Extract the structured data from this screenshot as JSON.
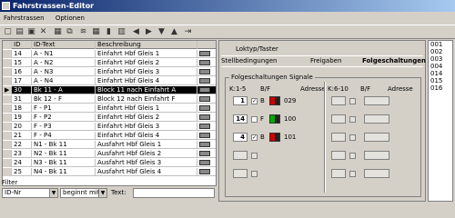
{
  "window": {
    "title": "Fahrstrassen-Editor"
  },
  "menu": {
    "items": [
      "Fahrstrassen",
      "Optionen"
    ]
  },
  "grid": {
    "headers": [
      "",
      "ID",
      "ID-Text",
      "Beschreibung",
      ""
    ],
    "rows": [
      {
        "marker": "",
        "id": "14",
        "text": "A - N1",
        "desc": "Einfahrt Hbf Gleis 1"
      },
      {
        "marker": "",
        "id": "15",
        "text": "A - N2",
        "desc": "Einfahrt Hbf Gleis 2"
      },
      {
        "marker": "",
        "id": "16",
        "text": "A - N3",
        "desc": "Einfahrt Hbf Gleis 3"
      },
      {
        "marker": "",
        "id": "17",
        "text": "A - N4",
        "desc": "Einfahrt Hbf Gleis 4"
      },
      {
        "marker": "▶",
        "id": "30",
        "text": "Bk 11 - A",
        "desc": "Block 11 nach Einfahrt A"
      },
      {
        "marker": "",
        "id": "31",
        "text": "Bk 12 - F",
        "desc": "Block 12 nach Einfahrt F"
      },
      {
        "marker": "",
        "id": "18",
        "text": "F - P1",
        "desc": "Einfahrt Hbf Gleis 1"
      },
      {
        "marker": "",
        "id": "19",
        "text": "F - P2",
        "desc": "Einfahrt Hbf Gleis 2"
      },
      {
        "marker": "",
        "id": "20",
        "text": "F - P3",
        "desc": "Einfahrt Hbf Gleis 3"
      },
      {
        "marker": "",
        "id": "21",
        "text": "F - P4",
        "desc": "Einfahrt Hbf Gleis 4"
      },
      {
        "marker": "",
        "id": "22",
        "text": "N1 - Bk 11",
        "desc": "Ausfahrt Hbf Gleis 1"
      },
      {
        "marker": "",
        "id": "23",
        "text": "N2 - Bk 11",
        "desc": "Ausfahrt Hbf Gleis 2"
      },
      {
        "marker": "",
        "id": "24",
        "text": "N3 - Bk 11",
        "desc": "Ausfahrt Hbf Gleis 3"
      },
      {
        "marker": "",
        "id": "25",
        "text": "N4 - Bk 11",
        "desc": "Ausfahrt Hbf Gleis 4"
      }
    ]
  },
  "filter": {
    "label": "Filter",
    "field": "ID-Nr",
    "mode": "beginnt mit",
    "text_label": "Text:",
    "text_value": ""
  },
  "tabs": {
    "row1": [
      "Loktyp/Taster"
    ],
    "row2": [
      "Stellbedingungen",
      "Freigaben",
      "Folgeschaltungen"
    ],
    "active": "Folgeschaltungen"
  },
  "folge": {
    "group_title": "Folgeschaltungen Signale",
    "headers": [
      "K:1-5",
      "B/F",
      "Adresse",
      "K:6-10",
      "B/F",
      "Adresse"
    ],
    "rows": [
      {
        "k": "1",
        "checked": true,
        "bf": "B",
        "addr": "029",
        "signal": "red"
      },
      {
        "k": "14",
        "checked": false,
        "bf": "F",
        "addr": "100",
        "signal": "green"
      },
      {
        "k": "4",
        "checked": true,
        "bf": "B",
        "addr": "101",
        "signal": "red"
      },
      {
        "k": "",
        "checked": false,
        "bf": "",
        "addr": "",
        "signal": ""
      },
      {
        "k": "",
        "checked": false,
        "bf": "",
        "addr": "",
        "signal": ""
      }
    ]
  },
  "list": {
    "items": [
      "001",
      "002",
      "003",
      "004",
      "014",
      "015",
      "016"
    ]
  }
}
